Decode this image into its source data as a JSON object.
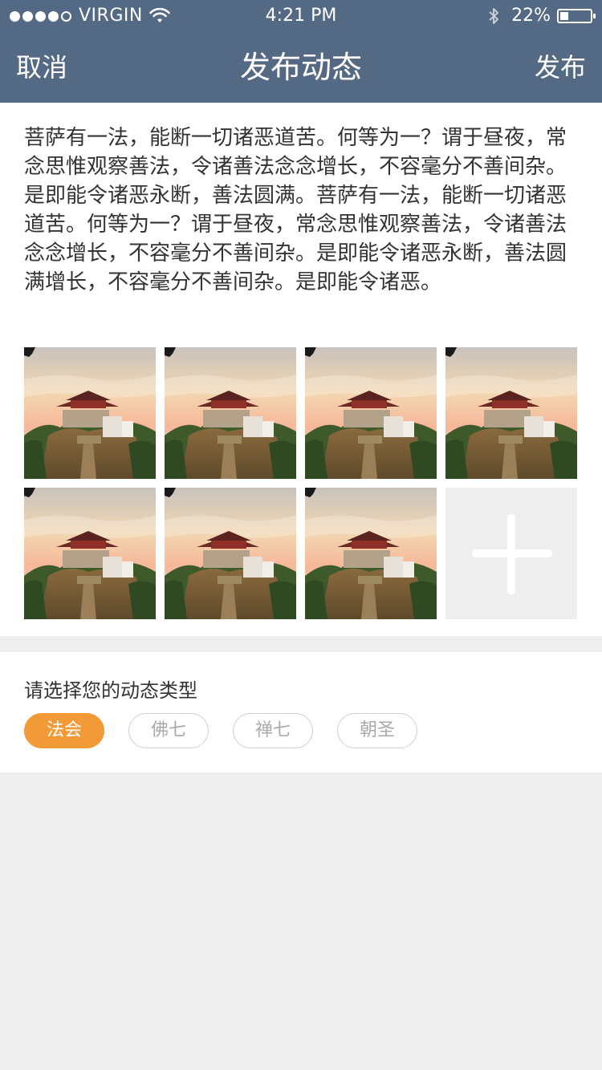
{
  "status_bar": {
    "carrier": "VIRGIN",
    "time": "4:21 PM",
    "battery": "22%"
  },
  "nav": {
    "cancel": "取消",
    "title": "发布动态",
    "publish": "发布"
  },
  "post": {
    "text": "菩萨有一法，能断一切诸恶道苦。何等为一？谓于昼夜，常念思惟观察善法，令诸善法念念增长，不容毫分不善间杂。是即能令诸恶永断，善法圆满。菩萨有一法，能断一切诸恶道苦。何等为一？谓于昼夜，常念思惟观察善法，令诸善法念念增长，不容毫分不善间杂。是即能令诸恶永断，善法圆满增长，不容毫分不善间杂。是即能令诸恶。"
  },
  "photos": {
    "count": 7,
    "add_icon": "plus-icon"
  },
  "types": {
    "label": "请选择您的动态类型",
    "options": [
      "法会",
      "佛七",
      "禅七",
      "朝圣"
    ],
    "selected": "法会"
  },
  "colors": {
    "header": "#546a84",
    "accent": "#f29a37"
  }
}
